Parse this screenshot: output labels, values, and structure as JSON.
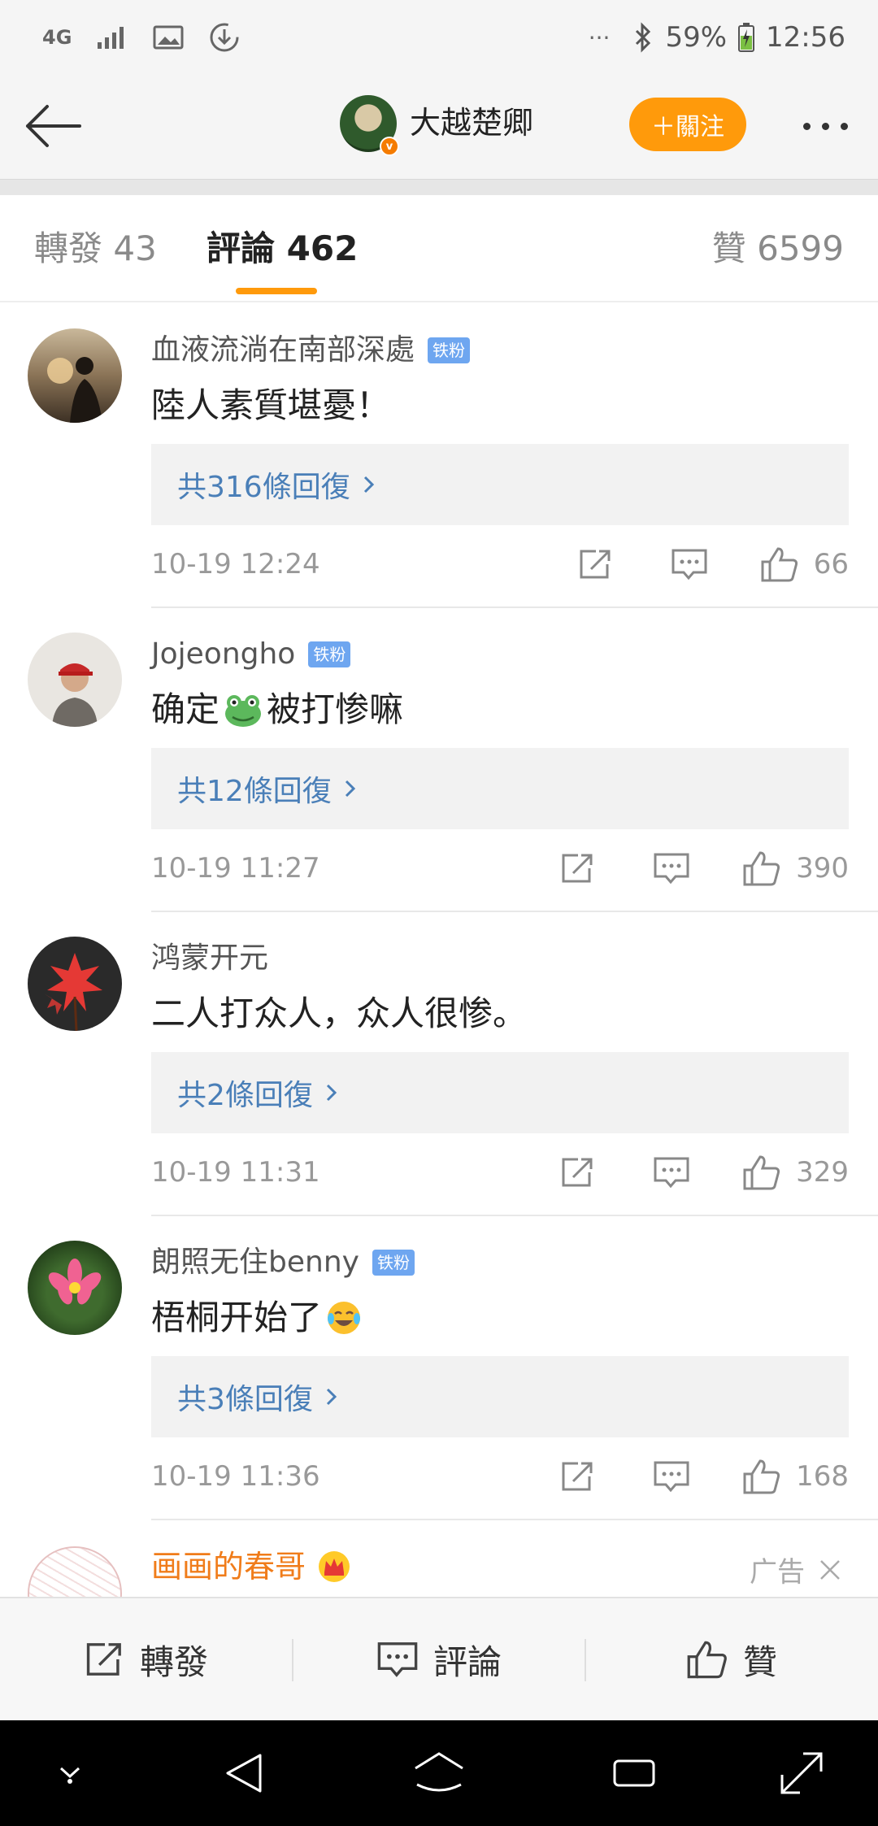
{
  "status_bar": {
    "network": "4G",
    "battery": "59%",
    "time": "12:56",
    "overflow": "···"
  },
  "header": {
    "title": "大越楚卿",
    "follow_label": "＋關注"
  },
  "tabs": {
    "repost": "轉發 43",
    "comments": "評論 462",
    "likes": "贊 6599"
  },
  "comments": [
    {
      "name": "血液流淌在南部深處",
      "badge": "铁粉",
      "text": "陸人素質堪憂！",
      "emoji": "",
      "text_after": "",
      "replies": "共316條回復",
      "time": "10-19 12:24",
      "likes": "66"
    },
    {
      "name": "Jojeongho",
      "badge": "铁粉",
      "text": "确定",
      "emoji": "frog-emoji",
      "text_after": "被打惨嘛",
      "replies": "共12條回復",
      "time": "10-19 11:27",
      "likes": "390"
    },
    {
      "name": "鸿蒙开元",
      "badge": "",
      "text": "二人打众人，众人很惨。",
      "emoji": "",
      "text_after": "",
      "replies": "共2條回復",
      "time": "10-19 11:31",
      "likes": "329"
    },
    {
      "name": "朗照无住benny",
      "badge": "铁粉",
      "text": "梧桐开始了",
      "emoji": "laugh-emoji",
      "text_after": "",
      "replies": "共3條回復",
      "time": "10-19 11:36",
      "likes": "168"
    }
  ],
  "ad": {
    "name": "画画的春哥",
    "tag": "广告"
  },
  "bottom_bar": {
    "repost": "轉發",
    "comment": "評論",
    "like": "贊"
  },
  "colors": {
    "accent": "#ff9a0b",
    "link": "#4a7fb8",
    "badge": "#6ea6f0",
    "ad_name": "#f07c1a"
  }
}
